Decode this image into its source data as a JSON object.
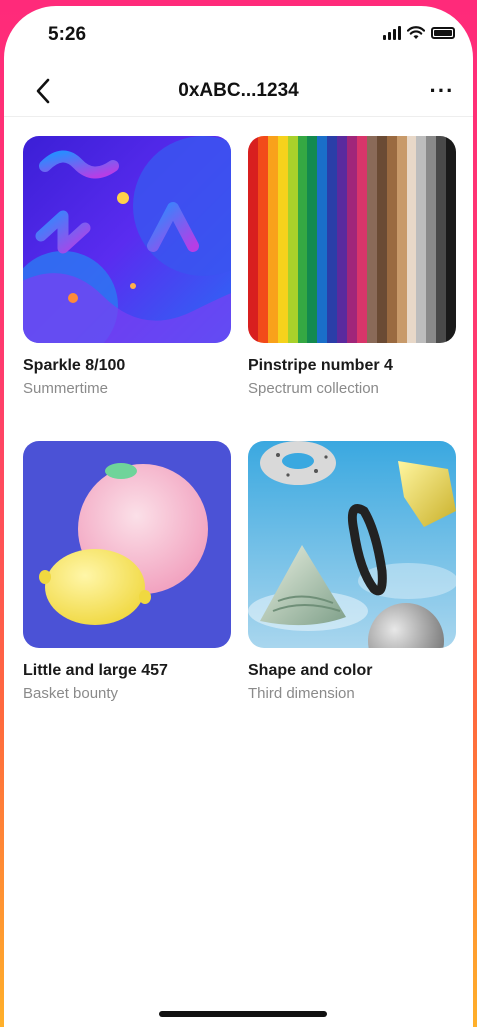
{
  "status_bar": {
    "time": "5:26"
  },
  "nav": {
    "title": "0xABC...1234",
    "more_label": "···"
  },
  "items": [
    {
      "title": "Sparkle 8/100",
      "subtitle": "Summertime"
    },
    {
      "title": "Pinstripe number 4",
      "subtitle": "Spectrum collection"
    },
    {
      "title": "Little and large 457",
      "subtitle": "Basket bounty"
    },
    {
      "title": "Shape and color",
      "subtitle": "Third dimension"
    }
  ],
  "colors": {
    "background_gradient": [
      "#ff2a7a",
      "#ffb02a"
    ],
    "text_primary": "#1a1a1a",
    "text_secondary": "#8a8a8a"
  },
  "icons": [
    "back-chevron-icon",
    "more-icon",
    "cellular-signal-icon",
    "wifi-icon",
    "battery-icon"
  ]
}
